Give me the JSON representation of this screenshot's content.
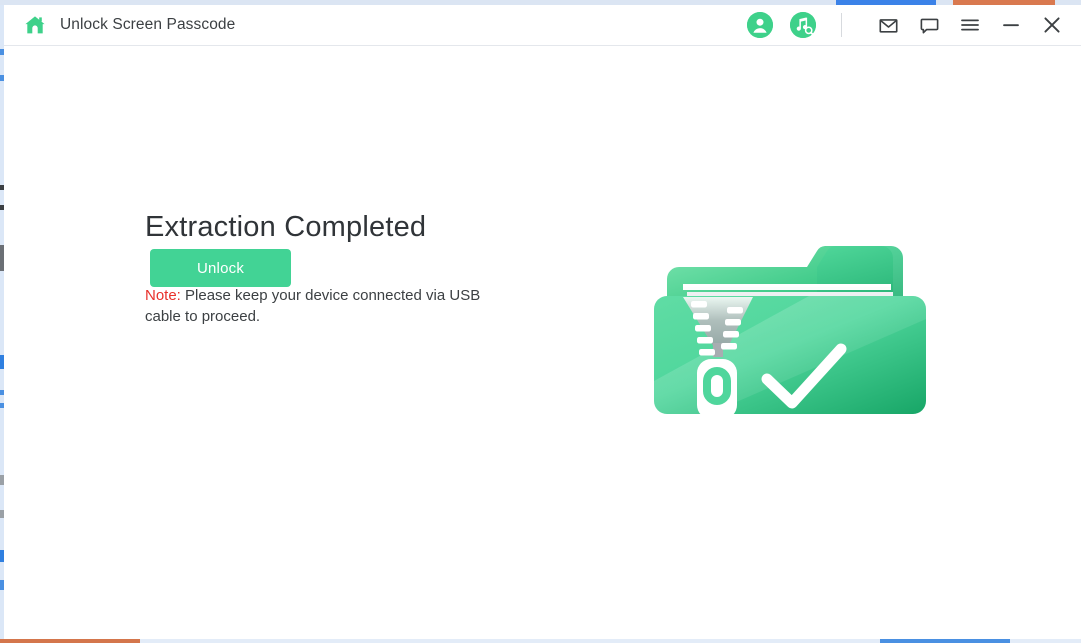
{
  "window": {
    "title": "Unlock Screen Passcode",
    "home_icon": "home-icon"
  },
  "titlebar": {
    "account_icon": "account-avatar-icon",
    "music_search_icon": "music-search-icon",
    "mail_icon": "mail-envelope-icon",
    "feedback_icon": "feedback-speech-bubble-icon",
    "menu_icon": "hamburger-menu-icon",
    "minimize_icon": "minimize-icon",
    "close_icon": "close-icon"
  },
  "main": {
    "headline": "Extraction Completed",
    "note_label": "Note:",
    "note_text": " Please keep your device connected via USB cable to proceed.",
    "unlock_label": "Unlock",
    "illustration_name": "zip-folder-completed-illustration"
  },
  "colors": {
    "accent_green": "#42d395",
    "note_red": "#e8312b",
    "title_text": "#3c4043",
    "headline_text": "#303438",
    "folder_green_light": "#6fe0a8",
    "folder_green_dark": "#1fa968",
    "window_bg": "#ffffff",
    "border": "#e4e7ec",
    "bleed_blue": "#3b82e8",
    "bleed_orange": "#d9794f"
  }
}
